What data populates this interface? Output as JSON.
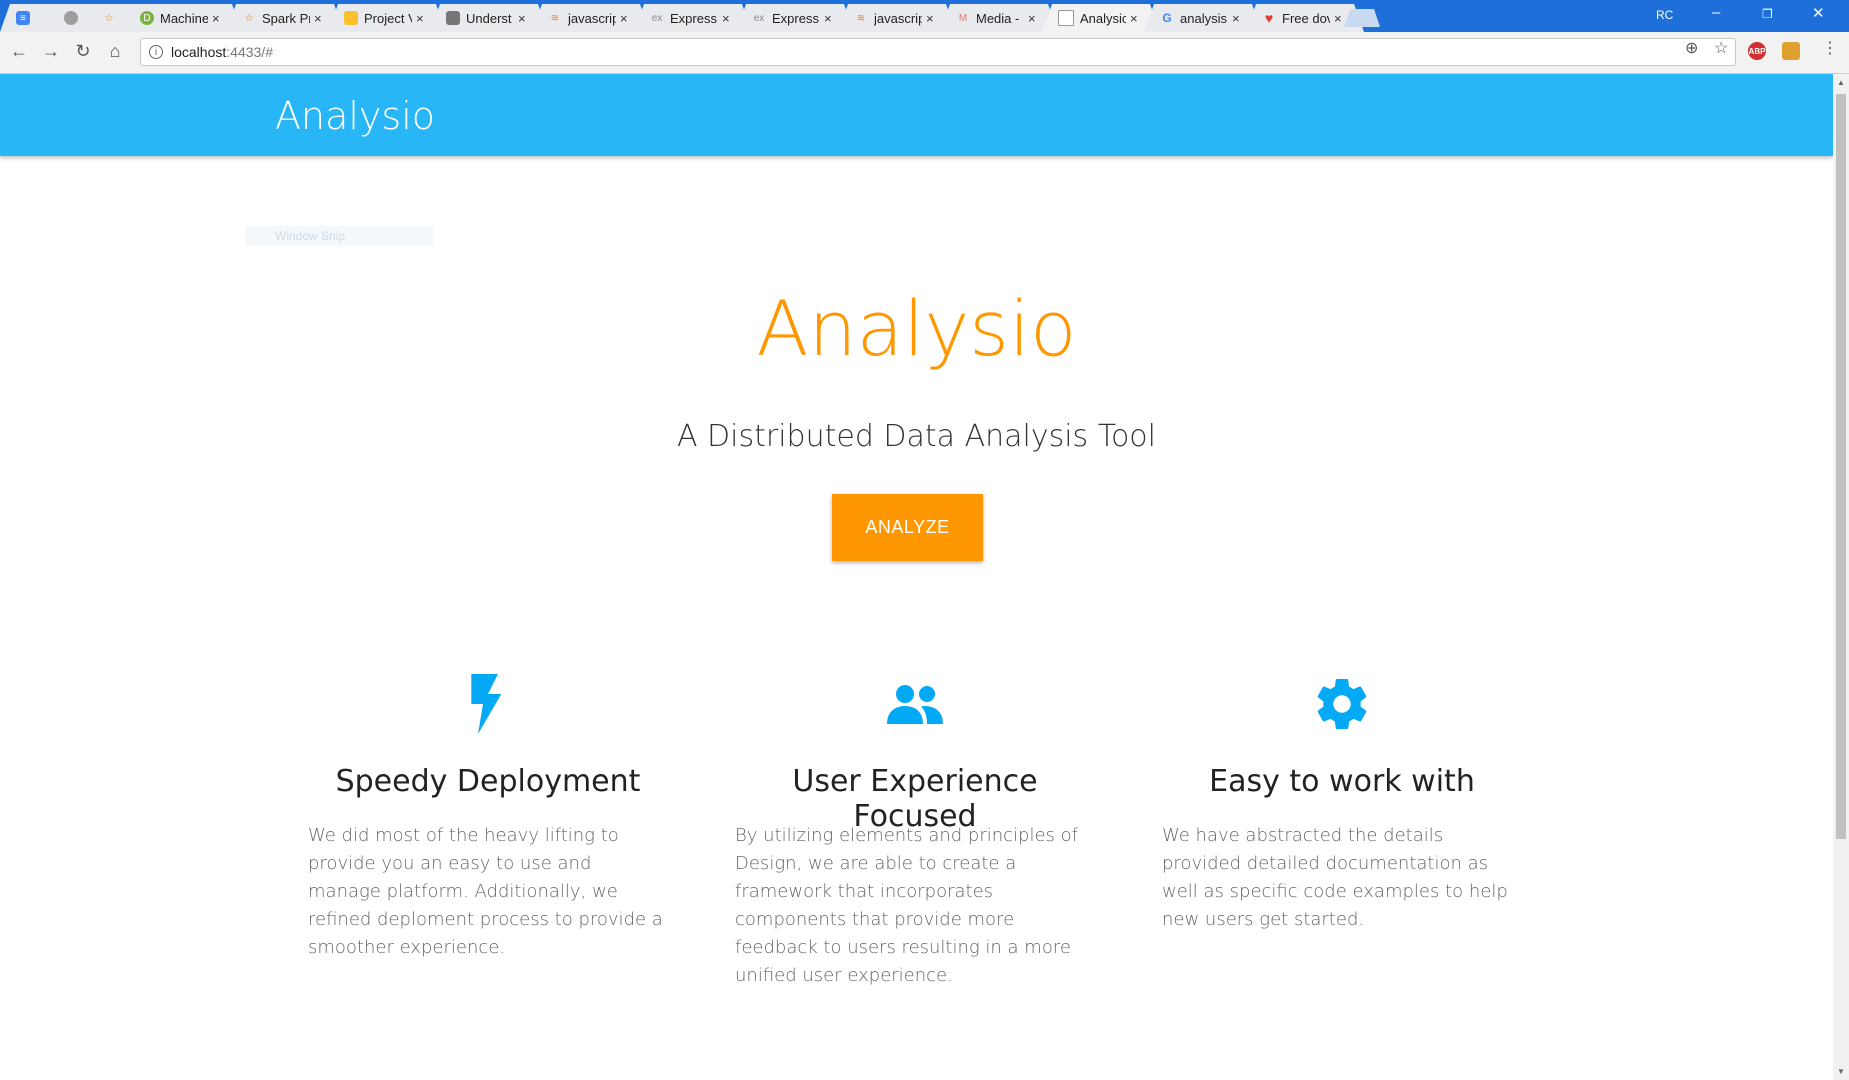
{
  "browser": {
    "tabs": [
      {
        "title": "",
        "favicon": "docs-icon",
        "color": "#4285f4"
      },
      {
        "title": "",
        "favicon": "edge-icon",
        "color": "#9e9e9e"
      },
      {
        "title": "",
        "favicon": "star-icon",
        "color": "#f57c00"
      },
      {
        "title": "Machine",
        "favicon": "d-icon",
        "color": "#7cb342"
      },
      {
        "title": "Spark Pr",
        "favicon": "spark-icon",
        "color": "#f57c00"
      },
      {
        "title": "Project V",
        "favicon": "slides-icon",
        "color": "#fbc02d"
      },
      {
        "title": "Underst",
        "favicon": "user-icon",
        "color": "#757575"
      },
      {
        "title": "javascrip",
        "favicon": "stackoverflow-icon",
        "color": "#f48024"
      },
      {
        "title": "Express",
        "favicon": "express-icon",
        "color": "#888888"
      },
      {
        "title": "Express -",
        "favicon": "express-icon",
        "color": "#888888"
      },
      {
        "title": "javascrip",
        "favicon": "stackoverflow-icon",
        "color": "#f48024"
      },
      {
        "title": "Media -",
        "favicon": "medium-icon",
        "color": "#e57373"
      },
      {
        "title": "Analysio",
        "favicon": "page-icon",
        "color": "#bdbdbd",
        "active": true
      },
      {
        "title": "analysis",
        "favicon": "google-icon",
        "color": "#4285f4"
      },
      {
        "title": "Free dov",
        "favicon": "heart-icon",
        "color": "#e53935"
      }
    ],
    "tab_close": "×",
    "profile": "RC",
    "url_host": "localhost",
    "url_rest": ":4433/#",
    "extensions": {
      "abp": "ABP"
    }
  },
  "app": {
    "brand": "Analysio",
    "snip_label": "Window Snip",
    "hero_title": "Analysio",
    "hero_subtitle": "A Distributed Data Analysis Tool",
    "cta_label": "ANALYZE",
    "accent_color": "#ff9800",
    "primary_color": "#29b6f6",
    "features": [
      {
        "icon": "flash-icon",
        "title": "Speedy Deployment",
        "text": "We did most of the heavy lifting to provide you an easy to use and manage platform. Additionally, we refined deploment process to provide a smoother experience."
      },
      {
        "icon": "group-icon",
        "title": "User Experience Focused",
        "text": "By utilizing elements and principles of Design, we are able to create a framework that incorporates components that provide more feedback to users resulting in a more unified user experience."
      },
      {
        "icon": "settings-icon",
        "title": "Easy to work with",
        "text": "We have abstracted the details provided detailed documentation as well as specific code examples to help new users get started."
      }
    ]
  }
}
